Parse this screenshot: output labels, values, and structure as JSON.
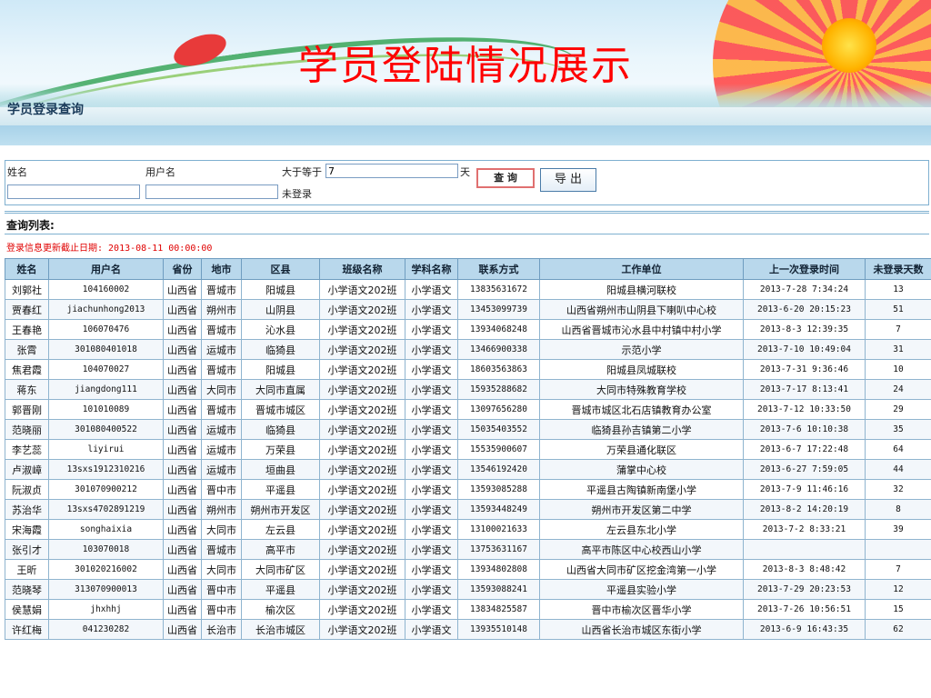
{
  "page": {
    "title": "学员登陆情况展示"
  },
  "subnav": {
    "label": "学员登录查询"
  },
  "form": {
    "name_label": "姓名",
    "name_value": "",
    "username_label": "用户名",
    "username_value": "",
    "gte_label": "大于等于",
    "days_value": "7",
    "days_unit": "天",
    "not_logged_label": "未登录",
    "query_button": "查 询",
    "export_button": "导 出"
  },
  "list": {
    "title": "查询列表:",
    "update_line": "登录信息更新截止日期: 2013-08-11 00:00:00"
  },
  "colors": {
    "title_red": "#ff0000",
    "header_bg": "#b9d8ec",
    "border": "#8fb4cf"
  },
  "table": {
    "headers": [
      "姓名",
      "用户名",
      "省份",
      "地市",
      "区县",
      "班级名称",
      "学科名称",
      "联系方式",
      "工作单位",
      "上一次登录时间",
      "未登录天数"
    ],
    "rows": [
      [
        "刘郭社",
        "104160002",
        "山西省",
        "晋城市",
        "阳城县",
        "小学语文202班",
        "小学语文",
        "13835631672",
        "阳城县横河联校",
        "2013-7-28 7:34:24",
        "13"
      ],
      [
        "贾春红",
        "jiachunhong2013",
        "山西省",
        "朔州市",
        "山阴县",
        "小学语文202班",
        "小学语文",
        "13453099739",
        "山西省朔州市山阴县下喇叭中心校",
        "2013-6-20 20:15:23",
        "51"
      ],
      [
        "王春艳",
        "106070476",
        "山西省",
        "晋城市",
        "沁水县",
        "小学语文202班",
        "小学语文",
        "13934068248",
        "山西省晋城市沁水县中村镇中村小学",
        "2013-8-3 12:39:35",
        "7"
      ],
      [
        "张霄",
        "301080401018",
        "山西省",
        "运城市",
        "临猗县",
        "小学语文202班",
        "小学语文",
        "13466900338",
        "示范小学",
        "2013-7-10 10:49:04",
        "31"
      ],
      [
        "焦君霞",
        "104070027",
        "山西省",
        "晋城市",
        "阳城县",
        "小学语文202班",
        "小学语文",
        "18603563863",
        "阳城县凤城联校",
        "2013-7-31 9:36:46",
        "10"
      ],
      [
        "蒋东",
        "jiangdong111",
        "山西省",
        "大同市",
        "大同市直属",
        "小学语文202班",
        "小学语文",
        "15935288682",
        "大同市特殊教育学校",
        "2013-7-17 8:13:41",
        "24"
      ],
      [
        "郭晋刚",
        "101010089",
        "山西省",
        "晋城市",
        "晋城市城区",
        "小学语文202班",
        "小学语文",
        "13097656280",
        "晋城市城区北石店镇教育办公室",
        "2013-7-12 10:33:50",
        "29"
      ],
      [
        "范晓丽",
        "301080400522",
        "山西省",
        "运城市",
        "临猗县",
        "小学语文202班",
        "小学语文",
        "15035403552",
        "临猗县孙吉镇第二小学",
        "2013-7-6 10:10:38",
        "35"
      ],
      [
        "李艺蕊",
        "liyirui",
        "山西省",
        "运城市",
        "万荣县",
        "小学语文202班",
        "小学语文",
        "15535900607",
        "万荣县通化联区",
        "2013-6-7 17:22:48",
        "64"
      ],
      [
        "卢淑嶂",
        "13sxs1912310216",
        "山西省",
        "运城市",
        "垣曲县",
        "小学语文202班",
        "小学语文",
        "13546192420",
        "蒲掌中心校",
        "2013-6-27 7:59:05",
        "44"
      ],
      [
        "阮淑贞",
        "301070900212",
        "山西省",
        "晋中市",
        "平遥县",
        "小学语文202班",
        "小学语文",
        "13593085288",
        "平遥县古陶镇新南堡小学",
        "2013-7-9 11:46:16",
        "32"
      ],
      [
        "苏治华",
        "13sxs4702891219",
        "山西省",
        "朔州市",
        "朔州市开发区",
        "小学语文202班",
        "小学语文",
        "13593448249",
        "朔州市开发区第二中学",
        "2013-8-2 14:20:19",
        "8"
      ],
      [
        "宋海霞",
        "songhaixia",
        "山西省",
        "大同市",
        "左云县",
        "小学语文202班",
        "小学语文",
        "13100021633",
        "左云县东北小学",
        "2013-7-2 8:33:21",
        "39"
      ],
      [
        "张引才",
        "103070018",
        "山西省",
        "晋城市",
        "高平市",
        "小学语文202班",
        "小学语文",
        "13753631167",
        "高平市陈区中心校西山小学",
        "",
        ""
      ],
      [
        "王昕",
        "301020216002",
        "山西省",
        "大同市",
        "大同市矿区",
        "小学语文202班",
        "小学语文",
        "13934802808",
        "山西省大同市矿区挖金湾第一小学",
        "2013-8-3 8:48:42",
        "7"
      ],
      [
        "范晓琴",
        "313070900013",
        "山西省",
        "晋中市",
        "平遥县",
        "小学语文202班",
        "小学语文",
        "13593088241",
        "平遥县实验小学",
        "2013-7-29 20:23:53",
        "12"
      ],
      [
        "侯慧娟",
        "jhxhhj",
        "山西省",
        "晋中市",
        "榆次区",
        "小学语文202班",
        "小学语文",
        "13834825587",
        "晋中市榆次区晋华小学",
        "2013-7-26 10:56:51",
        "15"
      ],
      [
        "许红梅",
        "041230282",
        "山西省",
        "长治市",
        "长治市城区",
        "小学语文202班",
        "小学语文",
        "13935510148",
        "山西省长治市城区东街小学",
        "2013-6-9 16:43:35",
        "62"
      ]
    ]
  }
}
